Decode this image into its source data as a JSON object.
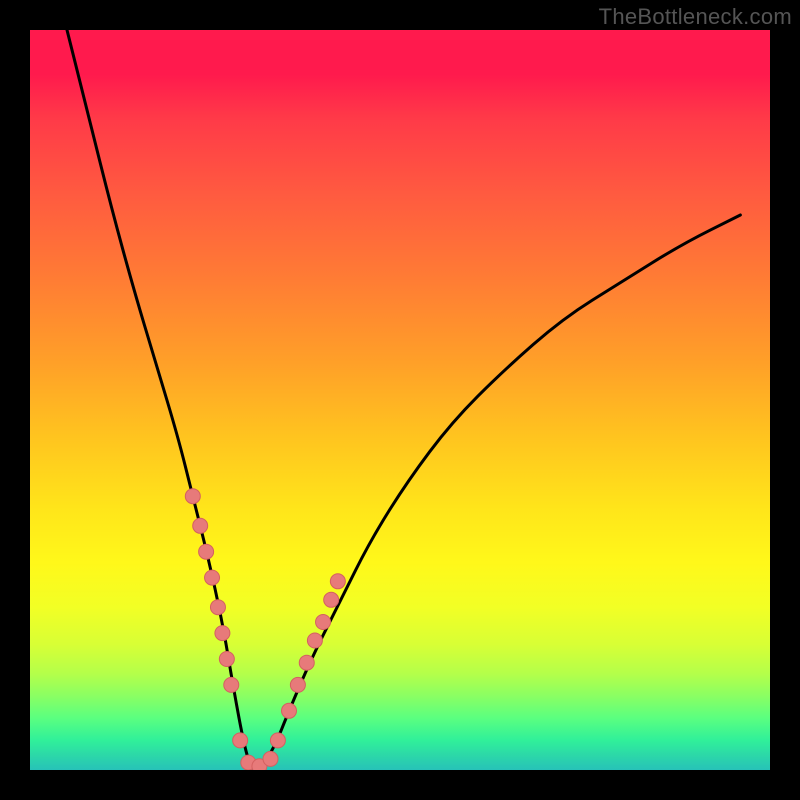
{
  "watermark": "TheBottleneck.com",
  "colors": {
    "frame": "#000000",
    "curve": "#000000",
    "marker_fill": "#e77a7a",
    "marker_stroke": "#d46060",
    "gradient_top": "#ff1a4d",
    "gradient_mid": "#ffe61a",
    "gradient_bottom": "#27c2b8"
  },
  "chart_data": {
    "type": "line",
    "title": "",
    "xlabel": "",
    "ylabel": "",
    "xlim": [
      0,
      100
    ],
    "ylim": [
      0,
      100
    ],
    "legend": false,
    "grid": false,
    "note": "V-shaped bottleneck curve over vertical rainbow gradient. X ≈ component balance, Y ≈ bottleneck % (0 at vertex). Values estimated from pixels.",
    "series": [
      {
        "name": "bottleneck-curve",
        "x": [
          5,
          8,
          11,
          14,
          17,
          20,
          22,
          24,
          26,
          27.5,
          29,
          30,
          31,
          33,
          35,
          38,
          42,
          46,
          51,
          57,
          64,
          72,
          80,
          88,
          96
        ],
        "y": [
          100,
          88,
          76,
          65,
          55,
          45,
          37,
          29,
          20,
          11,
          3,
          0,
          0,
          3,
          8,
          15,
          23,
          31,
          39,
          47,
          54,
          61,
          66,
          71,
          75
        ]
      }
    ],
    "markers": {
      "name": "highlight-dots",
      "x": [
        22.0,
        23.0,
        23.8,
        24.6,
        25.4,
        26.0,
        26.6,
        27.2,
        28.4,
        29.5,
        31.0,
        32.5,
        33.5,
        35.0,
        36.2,
        37.4,
        38.5,
        39.6,
        40.7,
        41.6
      ],
      "y": [
        37.0,
        33.0,
        29.5,
        26.0,
        22.0,
        18.5,
        15.0,
        11.5,
        4.0,
        1.0,
        0.5,
        1.5,
        4.0,
        8.0,
        11.5,
        14.5,
        17.5,
        20.0,
        23.0,
        25.5
      ]
    }
  }
}
